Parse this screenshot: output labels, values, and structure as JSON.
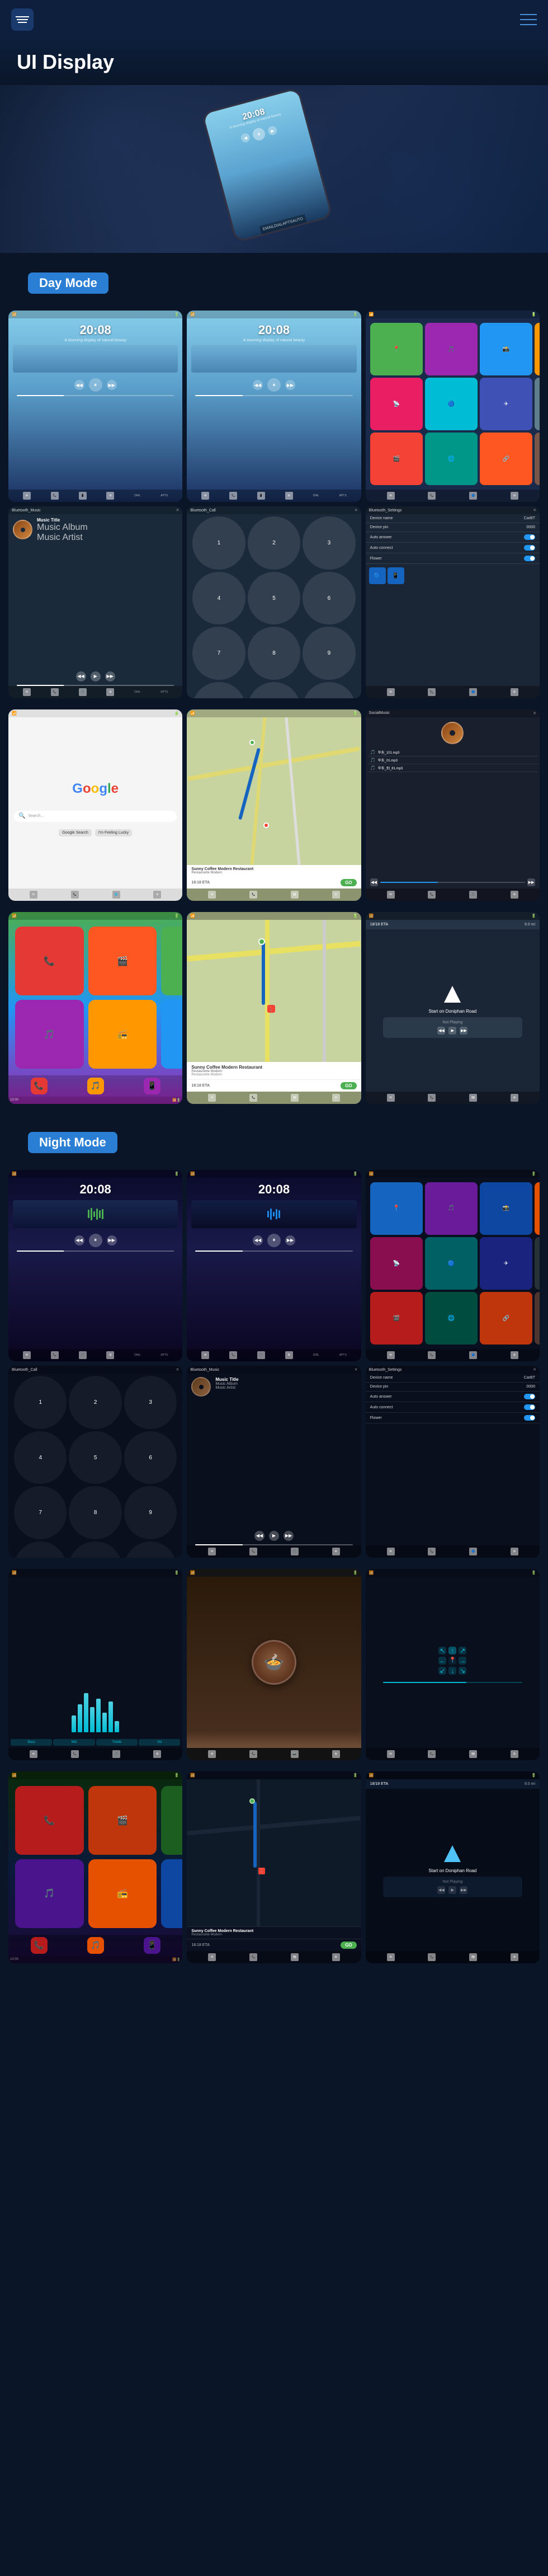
{
  "header": {
    "title": "UI Display",
    "menu_label": "Menu",
    "nav_label": "Navigation"
  },
  "hero": {
    "time": "20:08",
    "subtitle": "A stunning display of natural beauty"
  },
  "day_mode": {
    "label": "Day Mode",
    "screens": [
      {
        "type": "music_player",
        "time": "20:08",
        "subtitle": "A stunning display of natural beauty",
        "bg": "day"
      },
      {
        "type": "music_player2",
        "time": "20:08",
        "subtitle": "A stunning display of natural beauty",
        "bg": "day"
      },
      {
        "type": "apps_grid",
        "bg": "apps"
      },
      {
        "type": "bluetooth_music",
        "title": "Bluetooth_Music",
        "song": "Music Title",
        "album": "Music Album",
        "artist": "Music Artist"
      },
      {
        "type": "bluetooth_call",
        "title": "Bluetooth_Call"
      },
      {
        "type": "bluetooth_settings",
        "title": "Bluetooth_Settings",
        "device_name": "CarBT",
        "device_pin": "0000"
      },
      {
        "type": "google",
        "bg": "white"
      },
      {
        "type": "maps",
        "bg": "maps"
      },
      {
        "type": "social_music",
        "title": "SocialMusic"
      }
    ]
  },
  "day_mode_row2": {
    "screens": [
      {
        "type": "apps_ios",
        "bg": "apps"
      },
      {
        "type": "nav_map",
        "bg": "maps",
        "destination": "Sunny Coffee Modern Restaurant",
        "eta": "18:18 ETA",
        "distance": "GO"
      },
      {
        "type": "nav_driving",
        "bg": "nav",
        "time": "18/18 ETA",
        "distance": "9.0 mi",
        "direction": "Start on Doniphan Road"
      }
    ]
  },
  "night_mode": {
    "label": "Night Mode",
    "screens": [
      {
        "type": "music_player",
        "time": "20:08",
        "subtitle": "",
        "bg": "night"
      },
      {
        "type": "music_player2",
        "time": "20:08",
        "subtitle": "",
        "bg": "night"
      },
      {
        "type": "apps_grid_night",
        "bg": "apps_night"
      },
      {
        "type": "bluetooth_call_night",
        "title": "Bluetooth_Call"
      },
      {
        "type": "bluetooth_music_night",
        "title": "Bluetooth_Music",
        "song": "Music Title",
        "album": "Music Album",
        "artist": "Music Artist"
      },
      {
        "type": "bluetooth_settings_night",
        "title": "Bluetooth_Settings",
        "device_name": "CarBT",
        "device_pin": "0000"
      },
      {
        "type": "eq_screen",
        "bg": "eq"
      },
      {
        "type": "food_image",
        "bg": "food"
      },
      {
        "type": "nav_night",
        "bg": "nav_night"
      }
    ]
  },
  "night_mode_row2": {
    "screens": [
      {
        "type": "apps_ios_night"
      },
      {
        "type": "nav_map_night",
        "destination": "Sunny Coffee Modern Restaurant",
        "eta": "18:18 ETA"
      },
      {
        "type": "nav_driving_night",
        "time": "18/18 ETA",
        "distance": "9.0 mi",
        "direction": "Start on Doniphan Road"
      }
    ]
  },
  "app_colors": {
    "red": "#E53935",
    "green": "#43A047",
    "blue": "#1E88E5",
    "orange": "#FB8C00",
    "purple": "#8E24AA",
    "teal": "#00ACC1",
    "yellow": "#FDD835",
    "pink": "#E91E63",
    "indigo": "#3949AB",
    "cyan": "#00BCD4",
    "lime": "#C0CA33",
    "amber": "#FFB300"
  },
  "labels": {
    "email": "EMAIL",
    "dial": "DIAL",
    "apts": "APTS",
    "auto": "AUTO"
  }
}
